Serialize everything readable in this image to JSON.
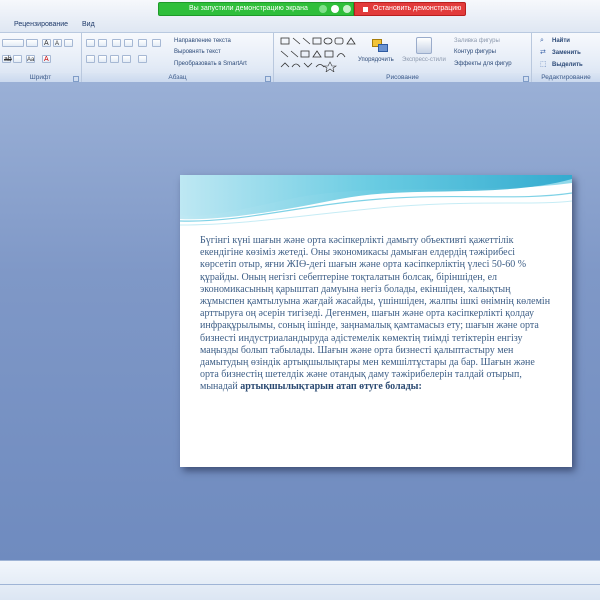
{
  "menu": {
    "tab_review": "Рецензирование",
    "tab_view": "Вид"
  },
  "share_banner": {
    "message": "Вы запустили демонстрацию экрана",
    "stop_label": "Остановить демонстрацию"
  },
  "ribbon": {
    "font": {
      "label": "Шрифт"
    },
    "paragraph": {
      "label": "Абзац",
      "text_direction": "Направление текста",
      "align_text": "Выровнять текст",
      "convert_smartart": "Преобразовать в SmartArt"
    },
    "drawing": {
      "label": "Рисование",
      "arrange": "Упорядочить",
      "quick_styles": "Экспресс-стили",
      "shape_fill": "Заливка фигуры",
      "shape_outline": "Контур фигуры",
      "shape_effects": "Эффекты для фигур"
    },
    "editing": {
      "label": "Редактирование",
      "find": "Найти",
      "replace": "Заменить",
      "select": "Выделить"
    }
  },
  "slide": {
    "body": "Бүгінгі күні шағын және орта кәсіпкерлікті дамыту объективті қажеттілік екендігіне көзіміз жетеді. Оны экономикасы дамыған елдердің тәжірибесі көрсетіп отыр, яғни ЖІӨ-дегі шағын және орта кәсіпкерліктің үлесі 50-60 % құрайды. Оның негізгі себептеріне тоқталатын болсақ, біріншіден, ел экономикасының қарыштап дамуына негіз болады, екіншіден, халықтың жұмыспен қамтылуына жағдай жасайды, үшіншіден, жалпы ішкі өнімнің көлемін арттыруға оң әсерін тигізеді.  Дегенмен, шағын және орта кәсіпкерлікті қолдау инфрақұрылымы, соның ішінде, заңнамалық қамтамасыз ету; шағын және орта бизнесті индустриаландыруда әдістемелік көмектің тиімді тетіктерін енгізу маңызды болып табылады. Шағын және орта бизнесті қалыптастыру мен дамытудың өзіндік артықшылықтары мен кемшілтұстары да бар. Шағын және орта бизнестің шетелдік және отандық  даму тәжірибелерін талдай отырып, мынадай ",
    "body_bold": "артықшылықтарын атап өтуге болады:"
  },
  "colors": {
    "workspace": "#7f98c7",
    "slide_text": "#3d5e86",
    "wave": "#5fc8e0",
    "share_green": "#2fbf3b",
    "share_red": "#e23b3b"
  }
}
